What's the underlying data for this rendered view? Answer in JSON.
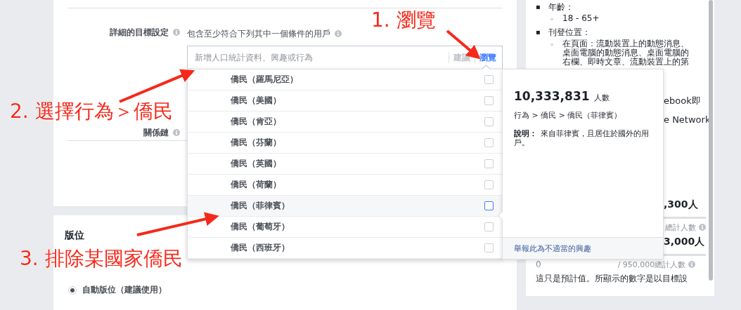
{
  "targeting": {
    "label": "詳細的目標設定",
    "hint": "包含至少符合下列其中一個條件的用戶",
    "search": {
      "placeholder": "新增人口統計資料、興趣或行為"
    },
    "modes": [
      {
        "label": "建議",
        "selected": false
      },
      {
        "label": "瀏覽",
        "selected": true
      }
    ]
  },
  "connections": {
    "label": "關係鏈"
  },
  "browse_list": [
    {
      "label": "僑民（羅馬尼亞）",
      "checked": false,
      "highlighted": false
    },
    {
      "label": "僑民（美國）",
      "checked": false,
      "highlighted": false
    },
    {
      "label": "僑民（肯亞）",
      "checked": false,
      "highlighted": false
    },
    {
      "label": "僑民（芬蘭）",
      "checked": false,
      "highlighted": false
    },
    {
      "label": "僑民（英國）",
      "checked": false,
      "highlighted": false
    },
    {
      "label": "僑民（荷蘭）",
      "checked": false,
      "highlighted": false
    },
    {
      "label": "僑民（菲律賓）",
      "checked": false,
      "highlighted": true
    },
    {
      "label": "僑民（葡萄牙）",
      "checked": false,
      "highlighted": false
    },
    {
      "label": "僑民（西班牙）",
      "checked": false,
      "highlighted": false
    }
  ],
  "detail_popup": {
    "count": "10,333,831",
    "count_unit": "人數",
    "path": "行為 > 僑民 > 僑民（菲律賓）",
    "description_label": "說明：",
    "description": "來自菲律賓，且居住於國外的用戶。",
    "report_link": "舉報此為不適當的興趣"
  },
  "placements": {
    "title": "版位",
    "options": [
      {
        "label": "自動版位（建議使用）",
        "selected": true
      }
    ]
  },
  "summary": {
    "items": [
      {
        "bullet": "▪",
        "label": "年齡：",
        "children": [
          {
            "bullet": "◦",
            "label": "18 - 65+"
          }
        ]
      },
      {
        "bullet": "▪",
        "label": "刊登位置：",
        "children": [
          {
            "bullet": "◦",
            "label": "在頁面：流動裝置上的動態消息、桌面電腦的動態消息、桌面電腦的右欄、即時文章、流動裝置上的第"
          }
        ]
      }
    ],
    "fragments": [
      {
        "text": "ebook即",
        "kind": "text"
      },
      {
        "text": "e Network",
        "kind": "text"
      },
      {
        "text": ",300人",
        "kind": "figure"
      },
      {
        "text": "總計人數",
        "kind": "caption"
      },
      {
        "text": "3,000人",
        "kind": "figure"
      },
      {
        "text": "/ 950,000總計人數",
        "kind": "scale",
        "start": "0"
      }
    ],
    "note": "這只是預計值。所顯示的數字是以目標設"
  },
  "annotations": [
    {
      "text": "1. 瀏覽"
    },
    {
      "text": "2. 選擇行為＞僑民"
    },
    {
      "text": "3. 排除某國家僑民"
    }
  ]
}
